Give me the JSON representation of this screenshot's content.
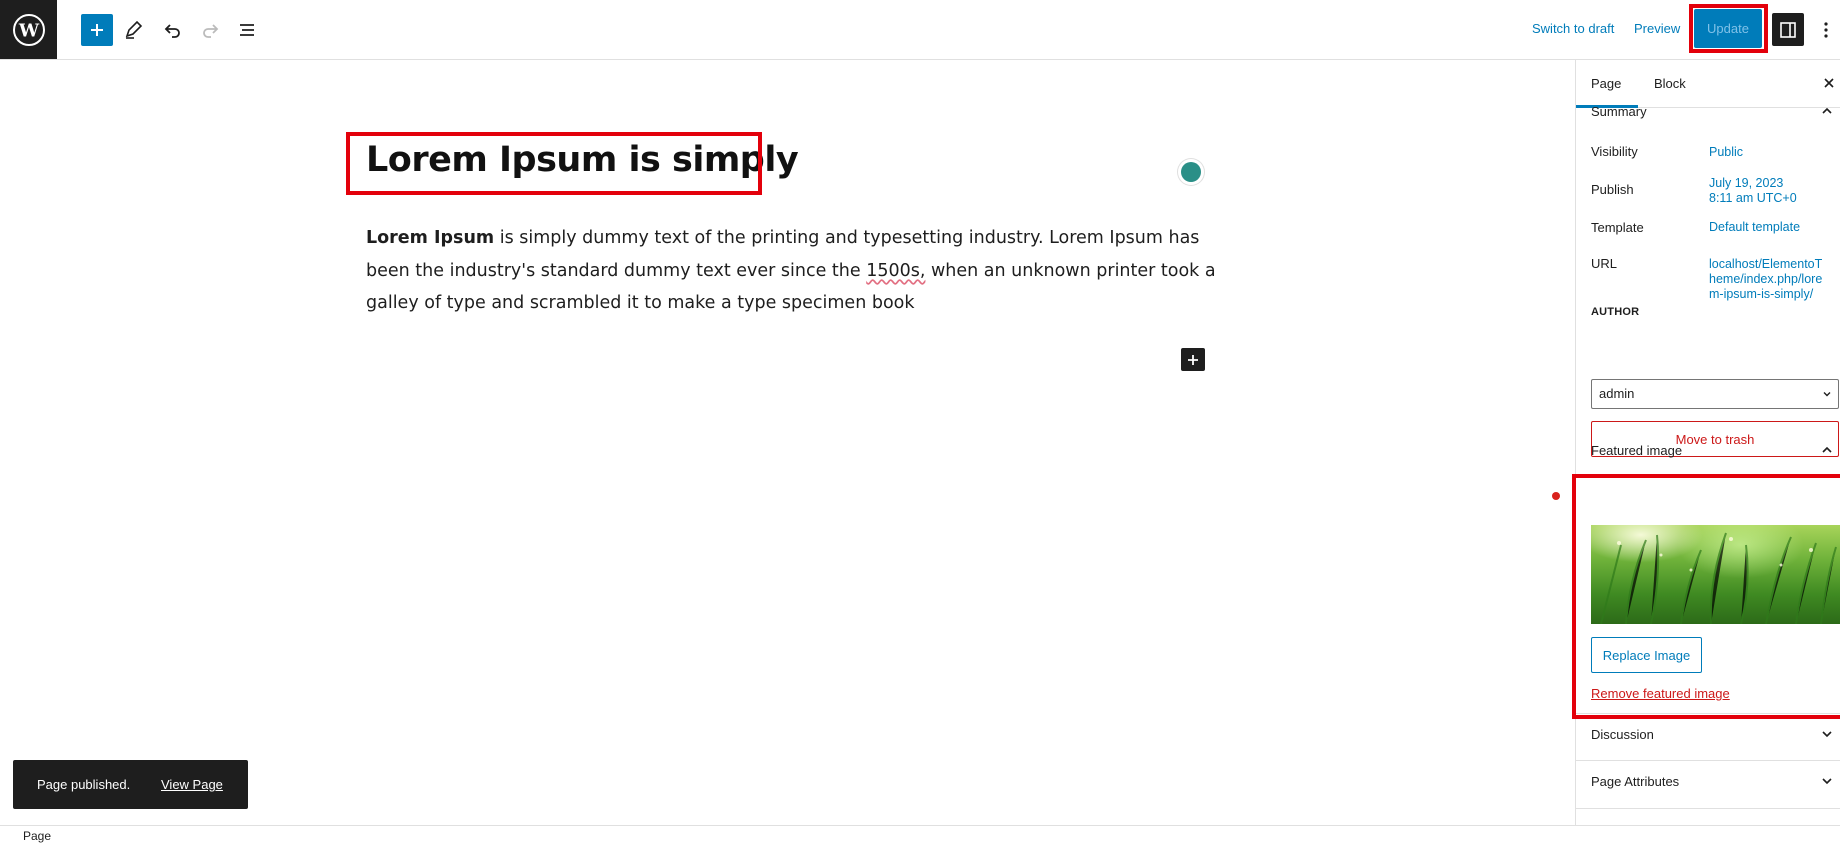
{
  "toolbar": {
    "switch_to_draft": "Switch to draft",
    "preview": "Preview",
    "update": "Update",
    "icons": [
      "wordpress-logo-icon",
      "plus-icon",
      "pencil-icon",
      "undo-icon",
      "redo-icon",
      "list-view-icon",
      "sidebar-toggle-icon",
      "more-vertical-icon"
    ]
  },
  "editor": {
    "title": "Lorem Ipsum is simply",
    "paragraph": {
      "bold_lead": "Lorem Ipsum",
      "text_a": " is simply dummy text of the printing and typesetting industry. Lorem Ipsum has been the industry's standard dummy text ever since the ",
      "misspelled": "1500s,",
      "text_b": " when an unknown printer took a galley of type and scrambled it to make a type specimen book"
    }
  },
  "sidebar": {
    "tabs": [
      "Page",
      "Block"
    ],
    "summary": {
      "title": "Summary",
      "visibility_label": "Visibility",
      "visibility_value": "Public",
      "publish_label": "Publish",
      "publish_value_line1": "July 19, 2023",
      "publish_value_line2": "8:11 am UTC+0",
      "template_label": "Template",
      "template_value": "Default template",
      "url_label": "URL",
      "url_line1": "localhost/ElementoT",
      "url_line2": "heme/index.php/lore",
      "url_line3": "m-ipsum-is-simply/",
      "author_label": "AUTHOR",
      "author_value": "admin",
      "trash_label": "Move to trash"
    },
    "featured_image": {
      "title": "Featured image",
      "replace_label": "Replace Image",
      "remove_label": "Remove featured image"
    },
    "discussion_title": "Discussion",
    "page_attributes_title": "Page Attributes"
  },
  "snackbar": {
    "message": "Page published.",
    "link": "View Page"
  },
  "footer": {
    "breadcrumb": "Page"
  },
  "colors": {
    "accent": "#007cba",
    "highlight": "#e3000b",
    "danger": "#cc1818",
    "dark": "#1e1e1e"
  }
}
